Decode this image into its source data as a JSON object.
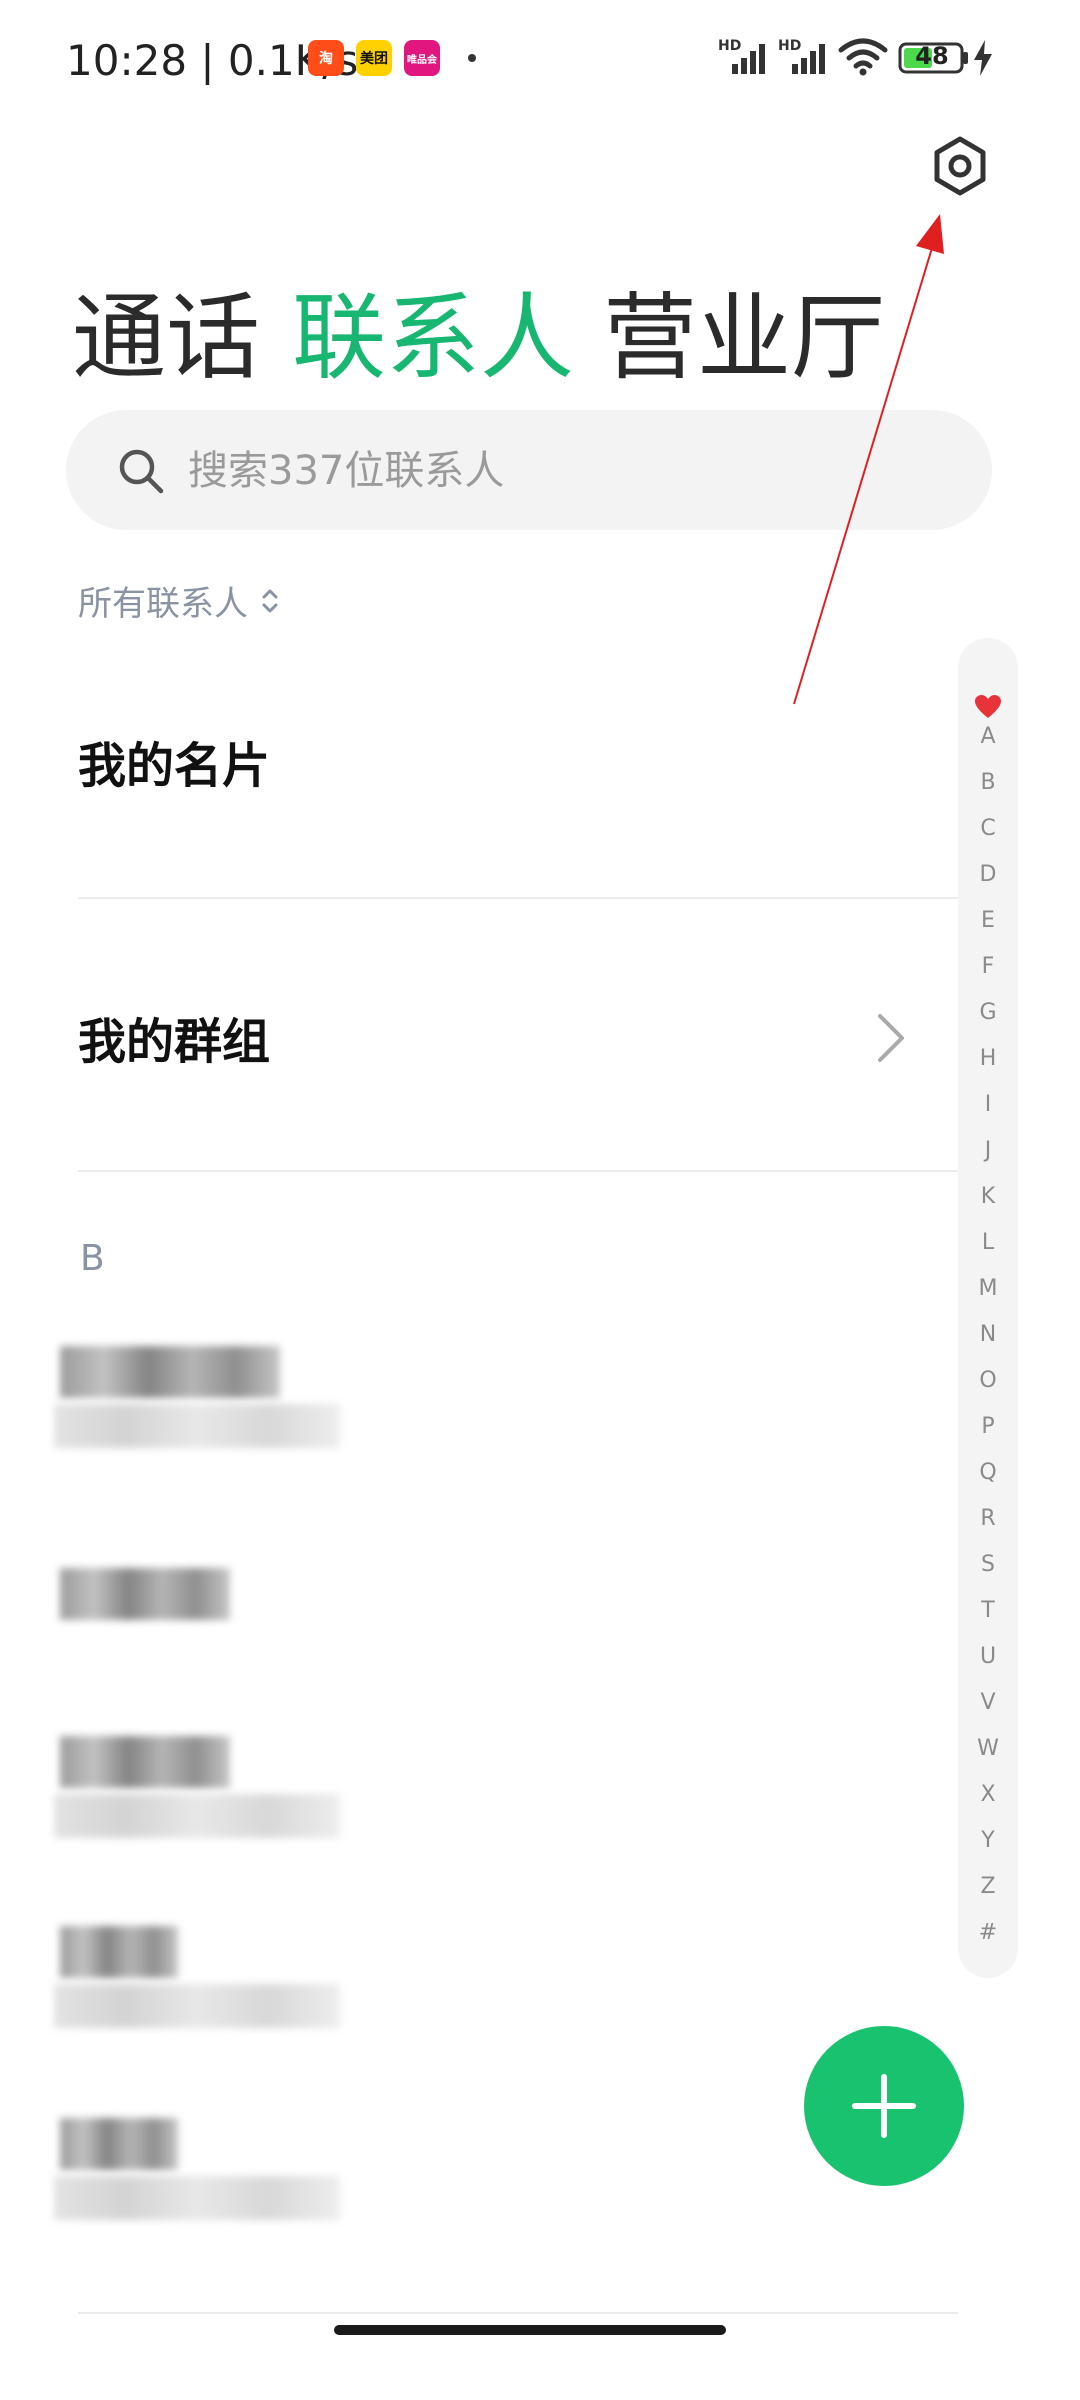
{
  "status_bar": {
    "time_speed": "10:28 | 0.1K/s",
    "app_icons": [
      "taobao-icon",
      "meituan-icon",
      "vip-icon"
    ],
    "app_icon_labels": {
      "taobao": "淘",
      "meituan": "美团",
      "vip": "唯品会"
    },
    "hd1": "HD",
    "hd2": "HD",
    "battery": "48"
  },
  "tabs": [
    {
      "label": "通话"
    },
    {
      "label": "联系人"
    },
    {
      "label": "营业厅"
    }
  ],
  "search": {
    "placeholder": "搜索337位联系人"
  },
  "filter": {
    "label": "所有联系人"
  },
  "rows": {
    "my_card": "我的名片",
    "my_groups": "我的群组"
  },
  "section_letter": "B",
  "alphabet_index": [
    "A",
    "B",
    "C",
    "D",
    "E",
    "F",
    "G",
    "H",
    "I",
    "J",
    "K",
    "L",
    "M",
    "N",
    "O",
    "P",
    "Q",
    "R",
    "S",
    "T",
    "U",
    "V",
    "W",
    "X",
    "Y",
    "Z",
    "#"
  ],
  "colors": {
    "accent": "#17b772",
    "fab": "#19c26f",
    "heart": "#e8333a",
    "annotation": "#e02020"
  },
  "icons": {
    "settings": "gear-icon",
    "search": "search-icon",
    "chevron": "chevron-right-icon",
    "favorite": "heart-icon",
    "add": "plus-icon"
  }
}
